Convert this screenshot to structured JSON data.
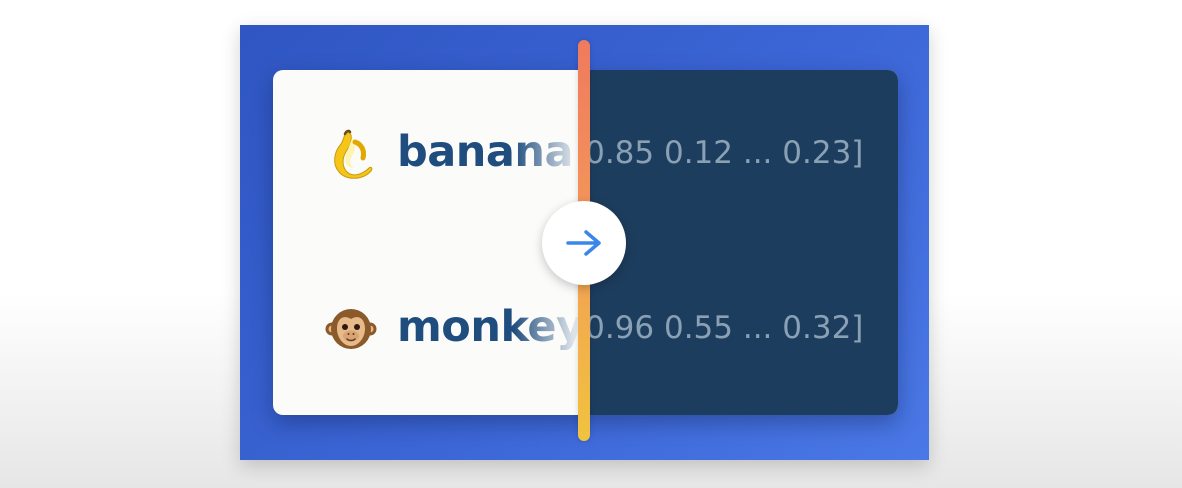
{
  "rows": [
    {
      "emoji_name": "banana-emoji",
      "word": "banana",
      "vector": "[0.85 0.12 ... 0.23]"
    },
    {
      "emoji_name": "monkey-emoji",
      "word": "monkey",
      "vector": "[0.96 0.55 ... 0.32]"
    }
  ],
  "transform_icon": "arrow-right-icon",
  "colors": {
    "background_panel": "#3a63d2",
    "left_card": "#fbfbfa",
    "right_card": "#1d3d5e",
    "word_text": "#1f4d7e",
    "vector_text": "#8aa0b4",
    "arrow": "#3a86ea",
    "divider_top": "#f07a5e",
    "divider_bottom": "#f0c33e"
  }
}
